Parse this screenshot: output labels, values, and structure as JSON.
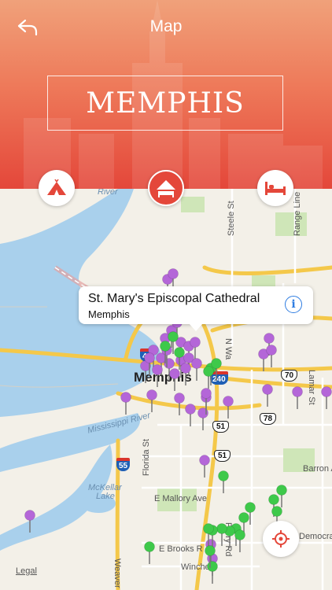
{
  "nav": {
    "title": "Map"
  },
  "header": {
    "city": "MEMPHIS"
  },
  "category_buttons": [
    {
      "name": "attractions",
      "icon": "tent-icon",
      "active": false
    },
    {
      "name": "hotels",
      "icon": "bed-icon",
      "active": true
    },
    {
      "name": "restaurants",
      "icon": "bed-icon",
      "active": false
    }
  ],
  "callout": {
    "title": "St. Mary's Episcopal Cathedral",
    "subtitle": "Memphis"
  },
  "map_labels": {
    "city": "Memphis",
    "river": "River",
    "mississippi": "Mississippi River",
    "mckellar": "McKellar",
    "lake": "Lake",
    "steele": "Steele St",
    "range_line": "Range Line Rd",
    "n_wat": "N Wa",
    "florida": "Florida St",
    "mallory": "E Mallory Ave",
    "perry": "Perry Rd",
    "brooks": "E Brooks R",
    "winches": "Winches",
    "weaver": "Weaver Rd",
    "barron": "Barron A",
    "democrat": "Democrat",
    "lamar": "Lamar St",
    "legal": "Legal"
  },
  "shields": {
    "i40": "40",
    "i240": "240",
    "i55": "55",
    "us51a": "51",
    "us51b": "51",
    "us70": "70",
    "us78": "78"
  },
  "colors": {
    "hotel_pin": "#b466d8",
    "attraction_pin": "#3ec94a",
    "accent": "#e4473a"
  }
}
